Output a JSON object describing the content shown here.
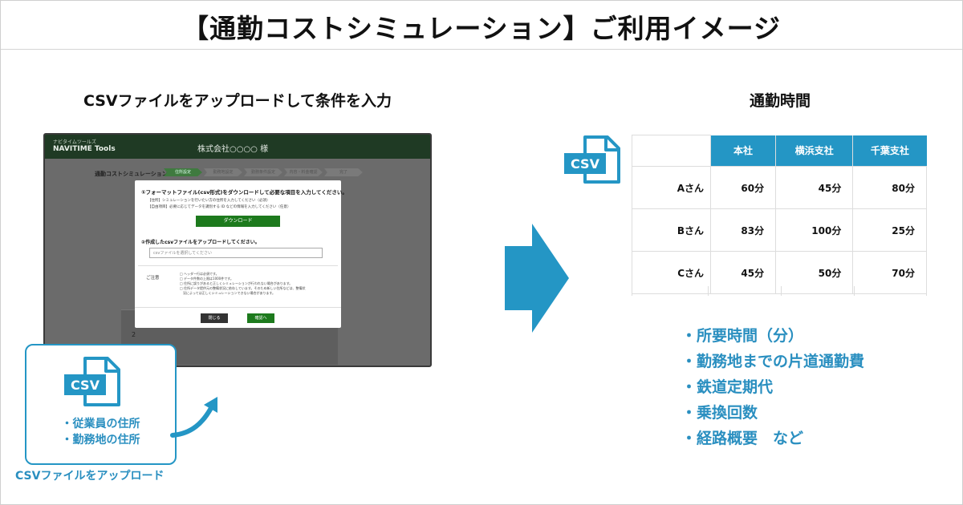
{
  "title": "【通勤コストシミュレーション】ご利用イメージ",
  "left_heading": "CSVファイルをアップロードして条件を入力",
  "right_heading": "通勤時間",
  "screenshot": {
    "brand_sub": "ナビタイムツールズ",
    "brand": "NAVITIME Tools",
    "company": "株式会社○○○○ 様",
    "sim_label": "通勤コストシミュレーション",
    "steps": [
      "住所設定",
      "勤務地設定",
      "勤務条件設定",
      "内容・料金確認",
      "完了"
    ],
    "modal": {
      "step1": "①フォーマットファイル(csv形式)をダウンロードして必要な項目を入力してください。",
      "hint1": "【住所】シミュレーションを行いたい方の住所を入力してください（必須）",
      "hint2": "【自由項目】必要に応じてデータを識別する ID などの情報を入力してください（任意）",
      "download": "ダウンロード",
      "step2": "②作成したcsvファイルをアップロードしてください。",
      "file_placeholder": "csvファイルを選択してください",
      "note_title": "ご注意",
      "notes": [
        "□ ヘッダー行は必須です。",
        "□ データ件数の上限は1000件です。",
        "□ 住所に誤りがあると正しくシミュレーションが行われない場合があります。",
        "□ 住所データ提供元の整備状況に依存しています。そのため新しい住所などは、整備状",
        "　況によっては正しくシミュレーションできない場合があります。"
      ],
      "close": "閉じる",
      "confirm": "確認へ"
    },
    "row_number": "2"
  },
  "csv_label": "CSV",
  "input_items": [
    "・従業員の住所",
    "・勤務地の住所"
  ],
  "upload_caption": "CSVファイルをアップロード",
  "table": {
    "headers": [
      "本社",
      "横浜支社",
      "千葉支社"
    ],
    "rows": [
      {
        "name": "Aさん",
        "values": [
          "60分",
          "45分",
          "80分"
        ]
      },
      {
        "name": "Bさん",
        "values": [
          "83分",
          "100分",
          "25分"
        ]
      },
      {
        "name": "Cさん",
        "values": [
          "45分",
          "50分",
          "70分"
        ]
      }
    ]
  },
  "outputs": [
    "・所要時間（分）",
    "・勤務地までの片道通勤費",
    "・鉄道定期代",
    "・乗換回数",
    "・経路概要　など"
  ],
  "colors": {
    "accent": "#2496c5",
    "green": "#1d7a1d",
    "dark_header": "#1f3a24"
  }
}
